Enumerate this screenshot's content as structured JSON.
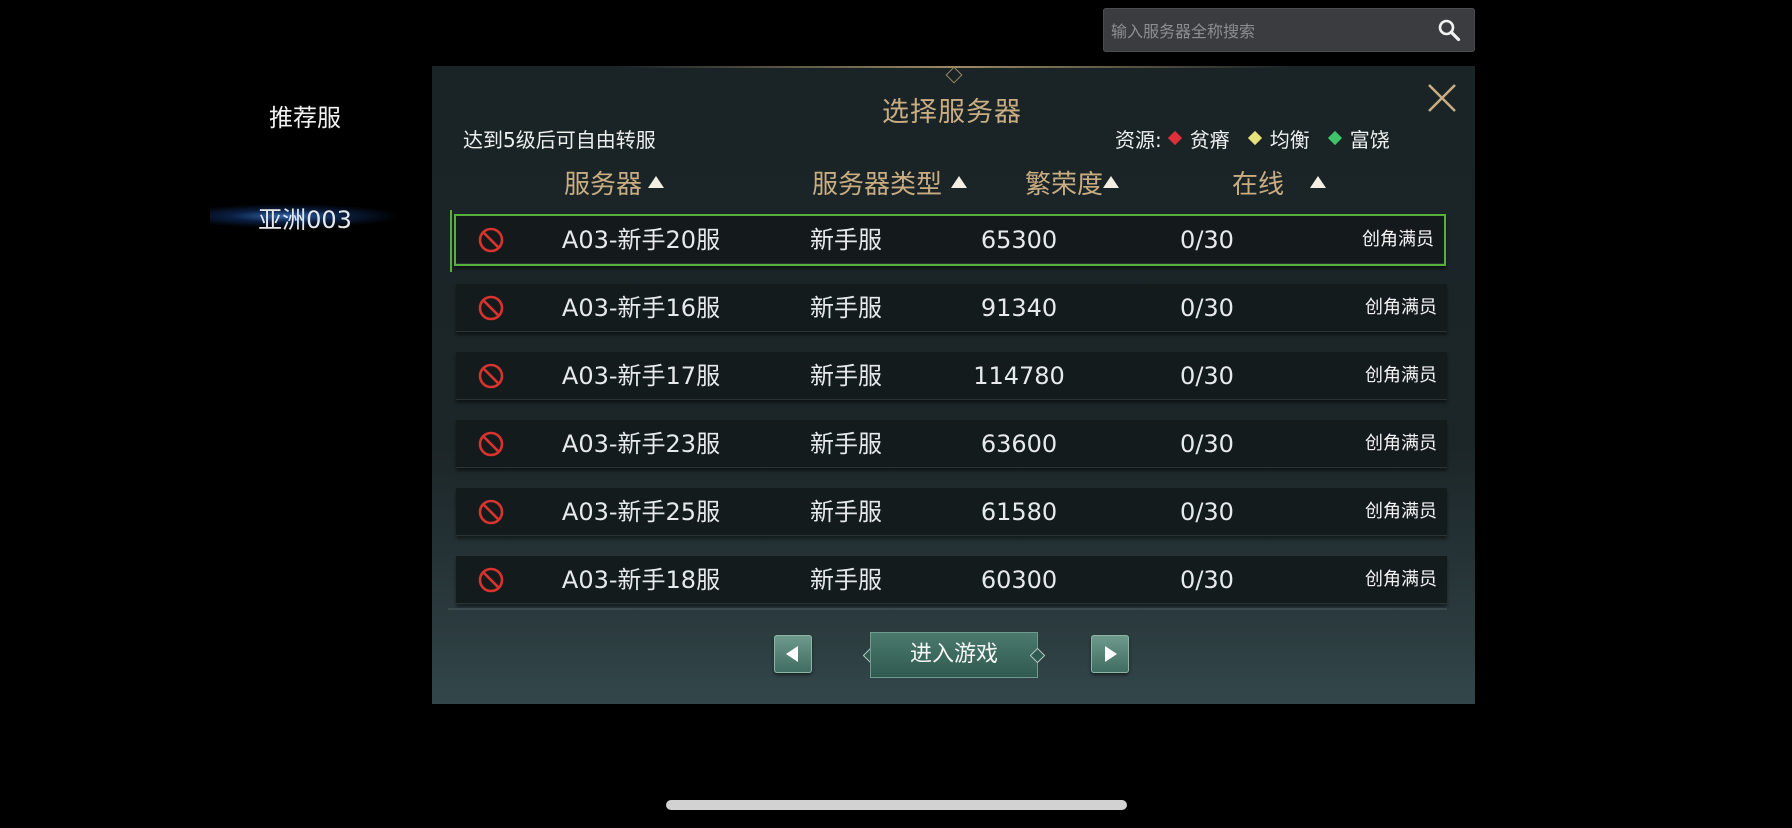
{
  "search": {
    "placeholder": "输入服务器全称搜索"
  },
  "sidebar": {
    "heading": "推荐服",
    "region": "亚洲003"
  },
  "panel": {
    "title": "选择服务器",
    "transfer_note": "达到5级后可自由转服",
    "resource_label": "资源:",
    "resources": [
      {
        "label": "贫瘠",
        "color": "#e0303a"
      },
      {
        "label": "均衡",
        "color": "#e8e27a"
      },
      {
        "label": "富饶",
        "color": "#3fc46a"
      }
    ]
  },
  "columns": {
    "server": "服务器",
    "type": "服务器类型",
    "prosperity": "繁荣度",
    "online": "在线"
  },
  "servers": [
    {
      "name": "A03-新手20服",
      "type": "新手服",
      "prosperity": "65300",
      "online": "0/30",
      "status": "创角满员",
      "selected": true
    },
    {
      "name": "A03-新手16服",
      "type": "新手服",
      "prosperity": "91340",
      "online": "0/30",
      "status": "创角满员"
    },
    {
      "name": "A03-新手17服",
      "type": "新手服",
      "prosperity": "114780",
      "online": "0/30",
      "status": "创角满员"
    },
    {
      "name": "A03-新手23服",
      "type": "新手服",
      "prosperity": "63600",
      "online": "0/30",
      "status": "创角满员"
    },
    {
      "name": "A03-新手25服",
      "type": "新手服",
      "prosperity": "61580",
      "online": "0/30",
      "status": "创角满员"
    },
    {
      "name": "A03-新手18服",
      "type": "新手服",
      "prosperity": "60300",
      "online": "0/30",
      "status": "创角满员"
    }
  ],
  "footer": {
    "enter_label": "进入游戏"
  },
  "icons": {
    "search": "search-icon",
    "close": "close-icon",
    "ban": "ban-icon",
    "prev": "arrow-left-icon",
    "next": "arrow-right-icon"
  },
  "colors": {
    "accent_gold": "#c9ad82",
    "selected_border": "#56b03b",
    "ban_red": "#d8332f"
  }
}
